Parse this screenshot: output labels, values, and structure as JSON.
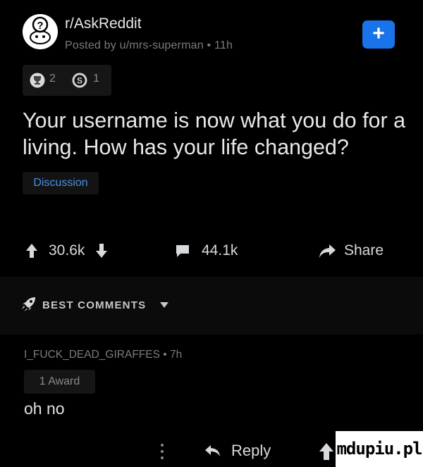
{
  "post": {
    "subreddit": "r/AskReddit",
    "meta": "Posted by u/mrs-superman • 11h",
    "award_counts": [
      "2",
      "1"
    ],
    "title": "Your username is now what you do for a living. How has your life changed?",
    "flair": "Discussion",
    "upvotes": "30.6k",
    "comments": "44.1k",
    "share_label": "Share"
  },
  "sort": {
    "label": "BEST COMMENTS"
  },
  "comment": {
    "meta": "I_FUCK_DEAD_GIRAFFES • 7h",
    "award": "1 Award",
    "body": "oh no",
    "reply_label": "Reply"
  },
  "watermark": "mdupiu.pl",
  "colors": {
    "background": "#000000",
    "accent": "#1a73e8",
    "flair_text": "#4a90e2",
    "muted_text": "#7c7c7c"
  },
  "icons": {
    "subreddit_avatar": "askreddit-snoo-icon",
    "join": "plus-icon",
    "award_1": "trophy-icon",
    "award_2": "coin-icon",
    "upvote": "arrow-up-icon",
    "downvote": "arrow-down-icon",
    "comments": "comment-bubble-icon",
    "share": "share-arrow-icon",
    "best": "rocket-icon",
    "sort_caret": "caret-down-icon",
    "more": "more-vertical-icon",
    "reply": "reply-icon"
  }
}
